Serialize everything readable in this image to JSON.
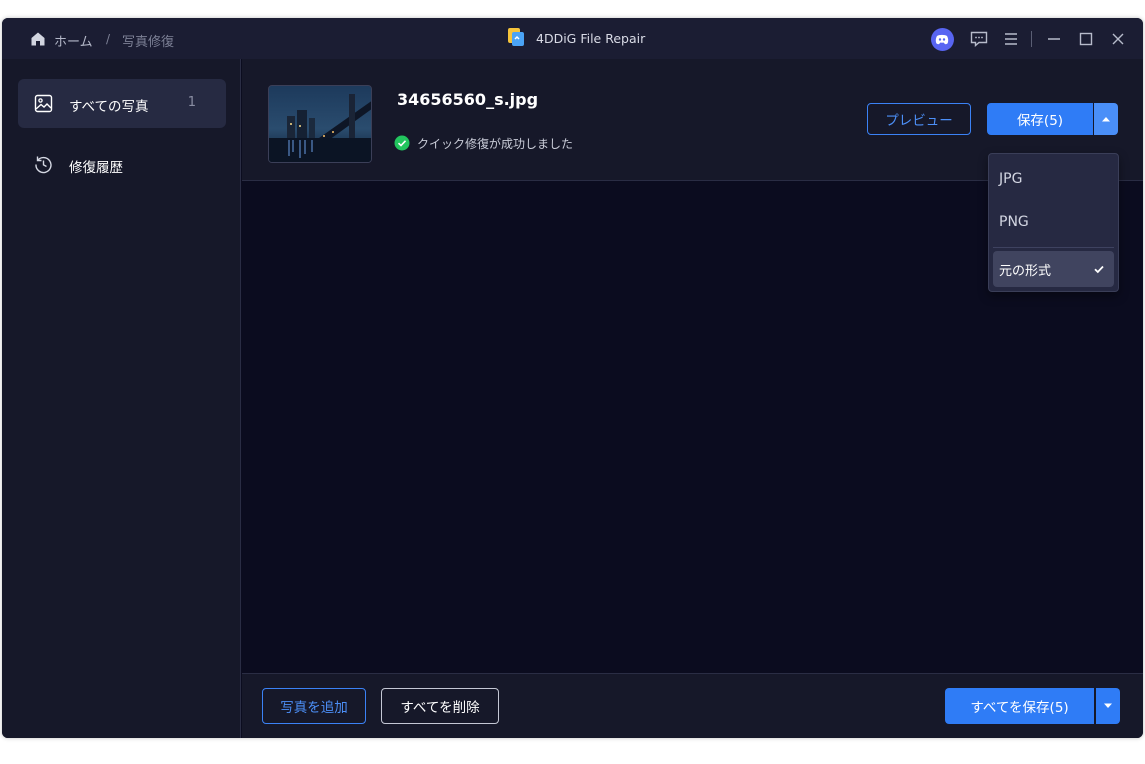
{
  "titlebar": {
    "breadcrumb_home": "ホーム",
    "breadcrumb_separator": "/",
    "breadcrumb_current": "写真修復",
    "app_title": "4DDiG File Repair",
    "icons": [
      "home-icon",
      "app-logo-icon",
      "discord-icon",
      "feedback-icon",
      "menu-icon",
      "minimize-icon",
      "maximize-icon",
      "close-icon"
    ]
  },
  "sidebar": {
    "items": [
      {
        "label": "すべての写真",
        "count": "1",
        "icon": "image-icon",
        "active": true
      },
      {
        "label": "修復履歴",
        "icon": "history-icon",
        "active": false
      }
    ]
  },
  "file": {
    "name": "34656560_s.jpg",
    "status": "クイック修復が成功しました",
    "status_icon": "check-circle-icon"
  },
  "actions": {
    "preview_label": "プレビュー",
    "save_label": "保存(5)"
  },
  "dropdown": {
    "options": [
      "JPG",
      "PNG",
      "元の形式"
    ],
    "selected": "元の形式"
  },
  "footer": {
    "add_label": "写真を追加",
    "delete_label": "すべてを削除",
    "save_all_label": "すべてを保存(5)"
  },
  "colors": {
    "accent": "#2f7cf6",
    "window_bg": "#0b0c1f",
    "panel_bg": "#161829",
    "success": "#22c55e"
  }
}
